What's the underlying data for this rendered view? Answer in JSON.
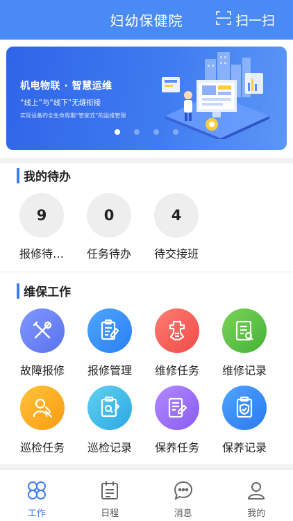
{
  "header": {
    "title": "妇幼保健院",
    "scan_label": "扫一扫",
    "scan_icon": "scan-icon"
  },
  "banner": {
    "heading": "机电物联 · 智慧运维",
    "subheading": "“线上”与“线下”无缝衔接",
    "small_text": "实现设备的全生命周期“管家式”的运维管理",
    "slide_count": 4,
    "active_slide": 0
  },
  "todo": {
    "title": "我的待办",
    "items": [
      {
        "count": "9",
        "label": "报修待…"
      },
      {
        "count": "0",
        "label": "任务待办"
      },
      {
        "count": "4",
        "label": "待交接班"
      }
    ]
  },
  "maintenance": {
    "title": "维保工作",
    "items": [
      {
        "label": "故障报修",
        "icon": "wrench-screwdriver-icon",
        "color_from": "#7f97ff",
        "color_to": "#5b73ee"
      },
      {
        "label": "报修管理",
        "icon": "clipboard-pen-icon",
        "color_from": "#4fa6ff",
        "color_to": "#2a7ff2"
      },
      {
        "label": "维修任务",
        "icon": "gear-tools-icon",
        "color_from": "#ff7c71",
        "color_to": "#f04b47"
      },
      {
        "label": "维修记录",
        "icon": "document-wrench-icon",
        "color_from": "#7cd35a",
        "color_to": "#44b236"
      },
      {
        "label": "巡检任务",
        "icon": "patrol-person-icon",
        "color_from": "#ffc43a",
        "color_to": "#f89a12"
      },
      {
        "label": "巡检记录",
        "icon": "document-search-icon",
        "color_from": "#5fd0f0",
        "color_to": "#2ba9e3"
      },
      {
        "label": "保养任务",
        "icon": "document-edit-icon",
        "color_from": "#b288ff",
        "color_to": "#8a5cf0"
      },
      {
        "label": "保养记录",
        "icon": "clipboard-shield-icon",
        "color_from": "#4ea3ff",
        "color_to": "#2a79ee"
      }
    ]
  },
  "tabbar": {
    "active": 0,
    "items": [
      {
        "label": "工作",
        "icon": "clover-grid-icon"
      },
      {
        "label": "日程",
        "icon": "calendar-list-icon"
      },
      {
        "label": "消息",
        "icon": "chat-bubble-icon"
      },
      {
        "label": "我的",
        "icon": "user-icon"
      }
    ]
  }
}
